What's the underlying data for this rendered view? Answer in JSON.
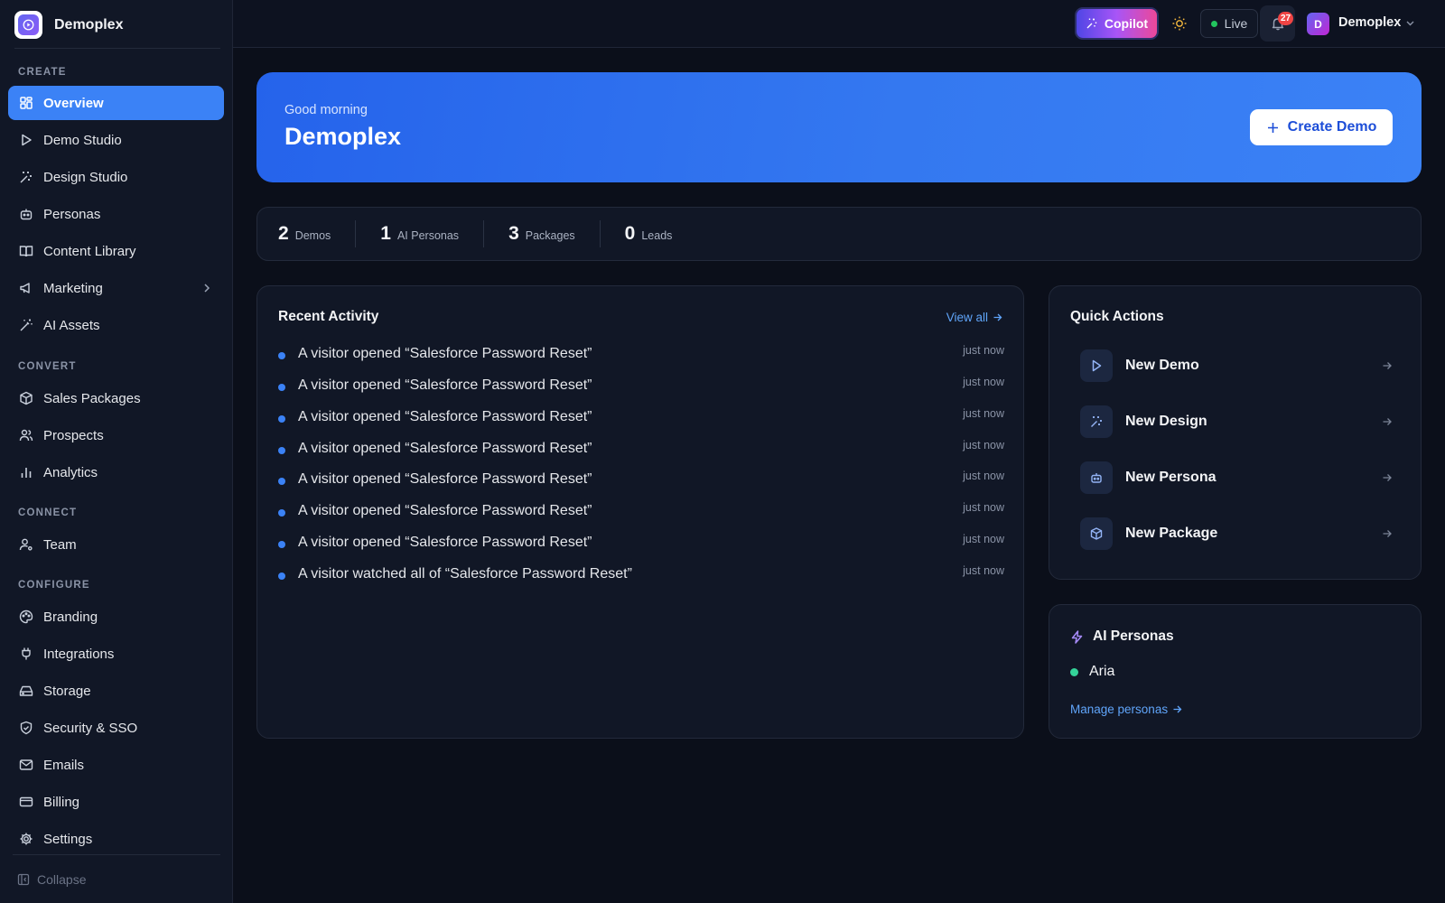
{
  "brand": {
    "name": "Demoplex"
  },
  "sidebar": {
    "sections": {
      "create": "CREATE",
      "convert": "CONVERT",
      "connect": "CONNECT",
      "configure": "CONFIGURE"
    },
    "items": {
      "overview": "Overview",
      "demo_studio": "Demo Studio",
      "design_studio": "Design Studio",
      "personas": "Personas",
      "content_library": "Content Library",
      "marketing": "Marketing",
      "ai_assets": "AI Assets",
      "sales_packages": "Sales Packages",
      "prospects": "Prospects",
      "analytics": "Analytics",
      "team": "Team",
      "branding": "Branding",
      "integrations": "Integrations",
      "storage": "Storage",
      "security_sso": "Security & SSO",
      "emails": "Emails",
      "billing": "Billing",
      "settings": "Settings"
    },
    "active": "overview",
    "collapse_label": "Collapse"
  },
  "topbar": {
    "copilot_label": "Copilot",
    "live_label": "Live",
    "notification_count": "27",
    "user_initial": "D",
    "user_name": "Demoplex"
  },
  "hero": {
    "greeting": "Good morning",
    "title": "Demoplex",
    "create_button": "Create Demo"
  },
  "stats": [
    {
      "value": "2",
      "label": "Demos"
    },
    {
      "value": "1",
      "label": "AI Personas"
    },
    {
      "value": "3",
      "label": "Packages"
    },
    {
      "value": "0",
      "label": "Leads"
    }
  ],
  "activity": {
    "title": "Recent Activity",
    "view_all": "View all",
    "items": [
      {
        "text": "A visitor opened “Salesforce Password Reset”",
        "time": "just now"
      },
      {
        "text": "A visitor opened “Salesforce Password Reset”",
        "time": "just now"
      },
      {
        "text": "A visitor opened “Salesforce Password Reset”",
        "time": "just now"
      },
      {
        "text": "A visitor opened “Salesforce Password Reset”",
        "time": "just now"
      },
      {
        "text": "A visitor opened “Salesforce Password Reset”",
        "time": "just now"
      },
      {
        "text": "A visitor opened “Salesforce Password Reset”",
        "time": "just now"
      },
      {
        "text": "A visitor opened “Salesforce Password Reset”",
        "time": "just now"
      },
      {
        "text": "A visitor watched all of “Salesforce Password Reset”",
        "time": "just now"
      }
    ]
  },
  "quick_actions": {
    "title": "Quick Actions",
    "items": [
      {
        "label": "New Demo",
        "icon": "play-icon"
      },
      {
        "label": "New Design",
        "icon": "sparkles-icon"
      },
      {
        "label": "New Persona",
        "icon": "bot-icon"
      },
      {
        "label": "New Package",
        "icon": "package-icon"
      }
    ]
  },
  "ai_personas": {
    "title": "AI Personas",
    "items": [
      {
        "name": "Aria",
        "status_color": "#34d399"
      }
    ],
    "manage_link": "Manage personas"
  },
  "colors": {
    "accent": "#3b82f6",
    "background": "#0b0f1a",
    "panel": "#111726",
    "live": "#22c55e",
    "badge": "#ef4444"
  }
}
